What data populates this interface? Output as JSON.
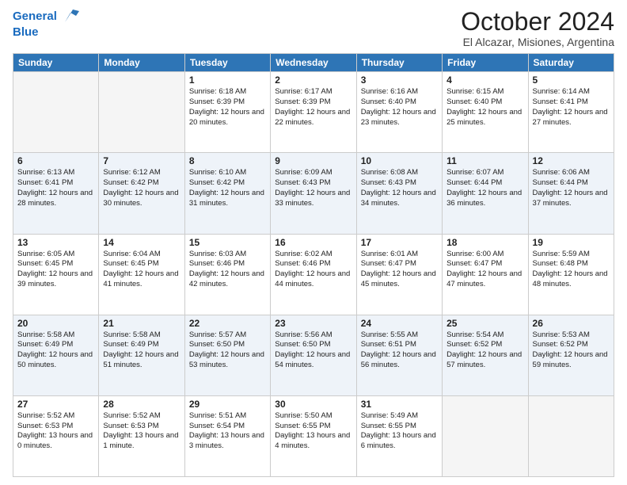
{
  "header": {
    "logo_line1": "General",
    "logo_line2": "Blue",
    "title": "October 2024",
    "subtitle": "El Alcazar, Misiones, Argentina"
  },
  "days_of_week": [
    "Sunday",
    "Monday",
    "Tuesday",
    "Wednesday",
    "Thursday",
    "Friday",
    "Saturday"
  ],
  "weeks": [
    [
      {
        "day": "",
        "info": ""
      },
      {
        "day": "",
        "info": ""
      },
      {
        "day": "1",
        "info": "Sunrise: 6:18 AM\nSunset: 6:39 PM\nDaylight: 12 hours and 20 minutes."
      },
      {
        "day": "2",
        "info": "Sunrise: 6:17 AM\nSunset: 6:39 PM\nDaylight: 12 hours and 22 minutes."
      },
      {
        "day": "3",
        "info": "Sunrise: 6:16 AM\nSunset: 6:40 PM\nDaylight: 12 hours and 23 minutes."
      },
      {
        "day": "4",
        "info": "Sunrise: 6:15 AM\nSunset: 6:40 PM\nDaylight: 12 hours and 25 minutes."
      },
      {
        "day": "5",
        "info": "Sunrise: 6:14 AM\nSunset: 6:41 PM\nDaylight: 12 hours and 27 minutes."
      }
    ],
    [
      {
        "day": "6",
        "info": "Sunrise: 6:13 AM\nSunset: 6:41 PM\nDaylight: 12 hours and 28 minutes."
      },
      {
        "day": "7",
        "info": "Sunrise: 6:12 AM\nSunset: 6:42 PM\nDaylight: 12 hours and 30 minutes."
      },
      {
        "day": "8",
        "info": "Sunrise: 6:10 AM\nSunset: 6:42 PM\nDaylight: 12 hours and 31 minutes."
      },
      {
        "day": "9",
        "info": "Sunrise: 6:09 AM\nSunset: 6:43 PM\nDaylight: 12 hours and 33 minutes."
      },
      {
        "day": "10",
        "info": "Sunrise: 6:08 AM\nSunset: 6:43 PM\nDaylight: 12 hours and 34 minutes."
      },
      {
        "day": "11",
        "info": "Sunrise: 6:07 AM\nSunset: 6:44 PM\nDaylight: 12 hours and 36 minutes."
      },
      {
        "day": "12",
        "info": "Sunrise: 6:06 AM\nSunset: 6:44 PM\nDaylight: 12 hours and 37 minutes."
      }
    ],
    [
      {
        "day": "13",
        "info": "Sunrise: 6:05 AM\nSunset: 6:45 PM\nDaylight: 12 hours and 39 minutes."
      },
      {
        "day": "14",
        "info": "Sunrise: 6:04 AM\nSunset: 6:45 PM\nDaylight: 12 hours and 41 minutes."
      },
      {
        "day": "15",
        "info": "Sunrise: 6:03 AM\nSunset: 6:46 PM\nDaylight: 12 hours and 42 minutes."
      },
      {
        "day": "16",
        "info": "Sunrise: 6:02 AM\nSunset: 6:46 PM\nDaylight: 12 hours and 44 minutes."
      },
      {
        "day": "17",
        "info": "Sunrise: 6:01 AM\nSunset: 6:47 PM\nDaylight: 12 hours and 45 minutes."
      },
      {
        "day": "18",
        "info": "Sunrise: 6:00 AM\nSunset: 6:47 PM\nDaylight: 12 hours and 47 minutes."
      },
      {
        "day": "19",
        "info": "Sunrise: 5:59 AM\nSunset: 6:48 PM\nDaylight: 12 hours and 48 minutes."
      }
    ],
    [
      {
        "day": "20",
        "info": "Sunrise: 5:58 AM\nSunset: 6:49 PM\nDaylight: 12 hours and 50 minutes."
      },
      {
        "day": "21",
        "info": "Sunrise: 5:58 AM\nSunset: 6:49 PM\nDaylight: 12 hours and 51 minutes."
      },
      {
        "day": "22",
        "info": "Sunrise: 5:57 AM\nSunset: 6:50 PM\nDaylight: 12 hours and 53 minutes."
      },
      {
        "day": "23",
        "info": "Sunrise: 5:56 AM\nSunset: 6:50 PM\nDaylight: 12 hours and 54 minutes."
      },
      {
        "day": "24",
        "info": "Sunrise: 5:55 AM\nSunset: 6:51 PM\nDaylight: 12 hours and 56 minutes."
      },
      {
        "day": "25",
        "info": "Sunrise: 5:54 AM\nSunset: 6:52 PM\nDaylight: 12 hours and 57 minutes."
      },
      {
        "day": "26",
        "info": "Sunrise: 5:53 AM\nSunset: 6:52 PM\nDaylight: 12 hours and 59 minutes."
      }
    ],
    [
      {
        "day": "27",
        "info": "Sunrise: 5:52 AM\nSunset: 6:53 PM\nDaylight: 13 hours and 0 minutes."
      },
      {
        "day": "28",
        "info": "Sunrise: 5:52 AM\nSunset: 6:53 PM\nDaylight: 13 hours and 1 minute."
      },
      {
        "day": "29",
        "info": "Sunrise: 5:51 AM\nSunset: 6:54 PM\nDaylight: 13 hours and 3 minutes."
      },
      {
        "day": "30",
        "info": "Sunrise: 5:50 AM\nSunset: 6:55 PM\nDaylight: 13 hours and 4 minutes."
      },
      {
        "day": "31",
        "info": "Sunrise: 5:49 AM\nSunset: 6:55 PM\nDaylight: 13 hours and 6 minutes."
      },
      {
        "day": "",
        "info": ""
      },
      {
        "day": "",
        "info": ""
      }
    ]
  ]
}
